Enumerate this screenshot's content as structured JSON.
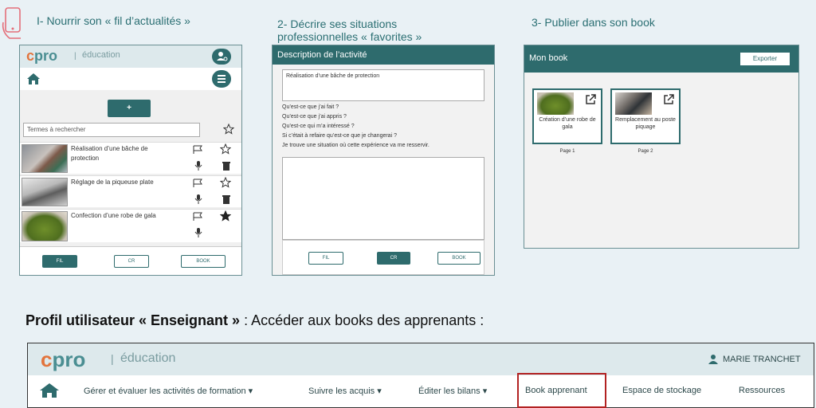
{
  "steps": {
    "s1": "I- Nourrir son « fil d’actualités »",
    "s2a": "2- Décrire ses situations",
    "s2b": "professionnelles « favorites »",
    "s3": "3- Publier dans son book"
  },
  "phone": {
    "logo_c": "c",
    "logo_rest": "pro",
    "logo_sep": "|",
    "logo_edu": "éducation",
    "add_label": "+",
    "search_placeholder": "Termes à rechercher",
    "items": [
      {
        "title": "Réalisation d’une bâche de protection"
      },
      {
        "title": "Réglage de la piqueuse plate"
      },
      {
        "title": "Confection d’une robe de gala"
      }
    ],
    "nav": {
      "fil": "FIL",
      "cr": "CR",
      "book": "BOOK"
    }
  },
  "desc": {
    "header": "Description de l’activité",
    "title_value": "Réalisation d’une bâche de protection",
    "questions": [
      "Qu’est-ce que j’ai fait ?",
      "Qu’est-ce que j’ai appris ?",
      "Qu’est-ce qui m’a intéressé ?",
      "Si c’était à refaire qu’est-ce que je changerai ?",
      "Je trouve une situation où cette expérience va me resservir."
    ],
    "nav": {
      "fil": "FIL",
      "cr": "CR",
      "book": "BOOK"
    }
  },
  "book": {
    "title": "Mon book",
    "export": "Exporter",
    "cards": [
      {
        "caption": "Création d’une robe de gala",
        "page": "Page 1"
      },
      {
        "caption": "Remplacement au poste piquage",
        "page": "Page 2"
      }
    ]
  },
  "profile": {
    "bold": "Profil utilisateur « Enseignant »",
    "rest": " : Accéder aux books des apprenants :"
  },
  "teacher_app": {
    "logo_c": "c",
    "logo_rest": "pro",
    "logo_sep": "|",
    "logo_edu": "éducation",
    "user": "MARIE TRANCHET",
    "menu": [
      {
        "label": "Gérer et évaluer les activités de formation",
        "caret": true
      },
      {
        "label": "Suivre les acquis",
        "caret": true
      },
      {
        "label": "Éditer les bilans",
        "caret": true
      },
      {
        "label": "Book apprenant",
        "caret": false
      },
      {
        "label": "Espace de stockage",
        "caret": false
      },
      {
        "label": "Ressources",
        "caret": false
      }
    ],
    "highlight_color": "#b22222"
  }
}
